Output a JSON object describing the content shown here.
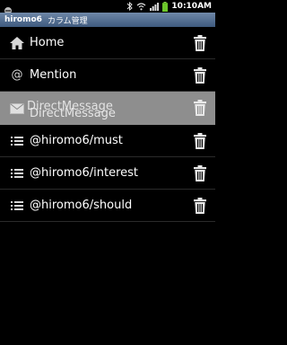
{
  "statusbar": {
    "time": "10:10AM"
  },
  "header": {
    "account": "hiromo6",
    "title": "カラム管理"
  },
  "columns": [
    {
      "label": "Home",
      "icon": "home-icon"
    },
    {
      "label": "Mention",
      "icon": "at-icon"
    },
    {
      "label": "DirectMessage",
      "icon": "envelope-icon"
    },
    {
      "label": "@hiromo6/must",
      "icon": "list-icon"
    },
    {
      "label": "@hiromo6/interest",
      "icon": "list-icon"
    },
    {
      "label": "@hiromo6/should",
      "icon": "list-icon"
    }
  ],
  "colors": {
    "titlebar": "#4f6b8f",
    "dragged_row": "#8e8e8e"
  }
}
